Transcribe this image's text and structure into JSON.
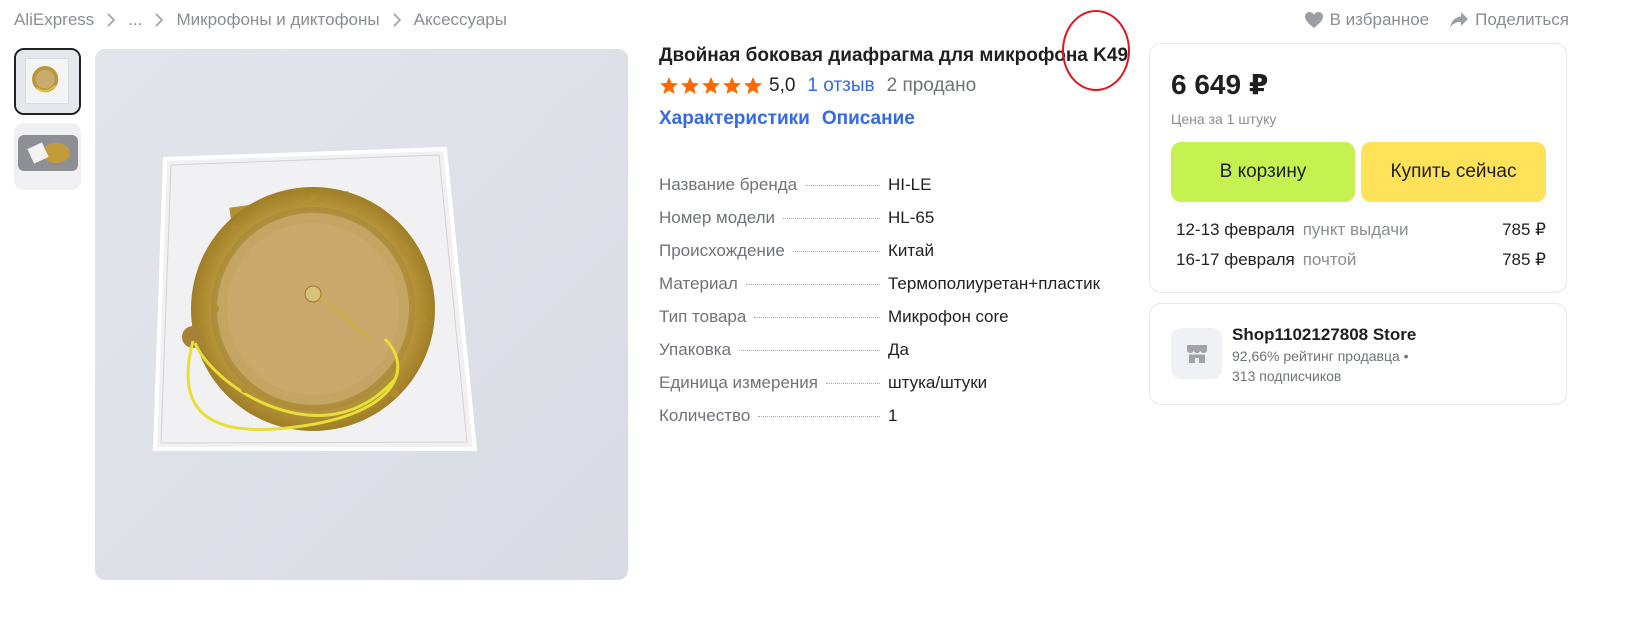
{
  "breadcrumb": {
    "items": [
      "AliExpress",
      "...",
      "Микрофоны и диктофоны",
      "Аксессуары"
    ]
  },
  "header": {
    "favorite_label": "В избранное",
    "share_label": "Поделиться"
  },
  "product": {
    "title": "Двойная боковая диафрагма для микрофона K49",
    "rating": "5,0",
    "rating_stars": 5,
    "reviews": "1 отзыв",
    "sold": "2 продано",
    "tabs": [
      "Характеристики",
      "Описание"
    ],
    "specs": [
      {
        "name": "Название бренда",
        "value": "HI-LE"
      },
      {
        "name": "Номер модели",
        "value": "HL-65"
      },
      {
        "name": "Происхождение",
        "value": "Китай"
      },
      {
        "name": "Материал",
        "value": "Термополиуретан+пластик"
      },
      {
        "name": "Тип товара",
        "value": "Микрофон core"
      },
      {
        "name": "Упаковка",
        "value": "Да"
      },
      {
        "name": "Единица измерения",
        "value": "штука/штуки"
      },
      {
        "name": "Количество",
        "value": "1"
      }
    ]
  },
  "buy_box": {
    "price": "6 649 ₽",
    "price_note": "Цена за 1 штуку",
    "add_to_cart": "В корзину",
    "buy_now": "Купить сейчас",
    "delivery": [
      {
        "date": "12-13 февраля",
        "method": "пункт выдачи",
        "cost": "785 ₽"
      },
      {
        "date": "16-17 февраля",
        "method": "почтой",
        "cost": "785 ₽"
      }
    ]
  },
  "store": {
    "name": "Shop1102127808 Store",
    "rating": "92,66% рейтинг продавца",
    "rating_separator": "•",
    "subscribers": "313 подписчиков"
  },
  "colors": {
    "link": "#3469e8",
    "cart_button": "#c5f250",
    "buy_button": "#fde25a",
    "star": "#ff6a00",
    "annotation": "#e0141e"
  },
  "icons": [
    "chevron-right-icon",
    "heart-icon",
    "share-icon",
    "star-icon",
    "store-icon"
  ]
}
